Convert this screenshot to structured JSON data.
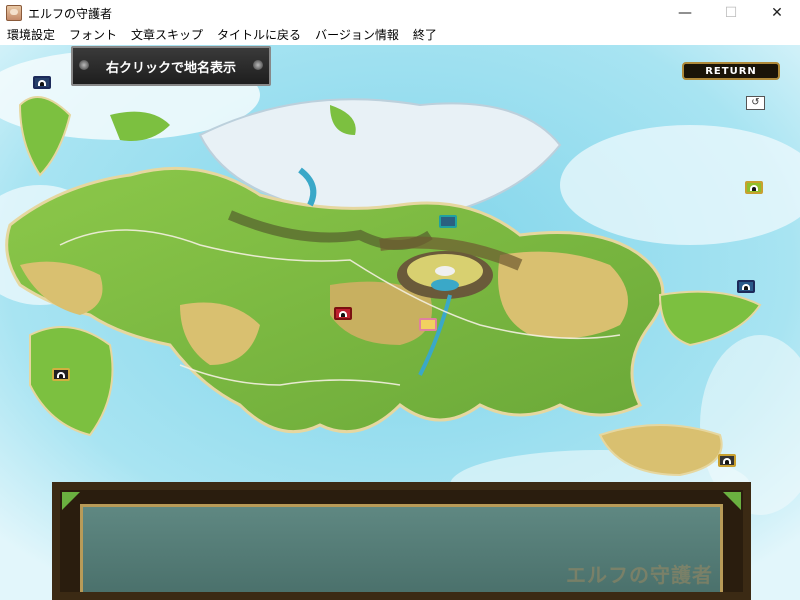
{
  "window": {
    "title": "エルフの守護者",
    "minimize": "—",
    "maximize": "☐",
    "close": "✕"
  },
  "menu": [
    {
      "label": "環境設定"
    },
    {
      "label": "フォント"
    },
    {
      "label": "文章スキップ"
    },
    {
      "label": "タイトルに戻る"
    },
    {
      "label": "バージョン情報"
    },
    {
      "label": "終了"
    }
  ],
  "game": {
    "hint_label": "右クリックで地名表示",
    "return_label": "RETURN",
    "swirl_icon": "swirl-icon",
    "watermark": "エルフの守護者",
    "markers": [
      {
        "name": "marker-northwest-island",
        "color": "#1c2a5a"
      },
      {
        "name": "marker-east-top",
        "color": "#8fbf2a"
      },
      {
        "name": "marker-east-coast",
        "color": "#2a5a8a"
      },
      {
        "name": "marker-central-red",
        "color": "#c02030"
      },
      {
        "name": "marker-west-island",
        "color": "#d0b040"
      },
      {
        "name": "marker-southeast",
        "color": "#c8a030"
      },
      {
        "name": "marker-selected",
        "color": "#e080a0"
      },
      {
        "name": "marker-mountain-gate",
        "color": "#20a0a0"
      }
    ]
  },
  "colors": {
    "sea": "#9fe0f0",
    "land_green": "#7cc040",
    "land_tan": "#d9c070",
    "mountain": "#6a7a3a",
    "snow": "#eef4f8",
    "dialog_frame": "#3b2a14",
    "dialog_fill": "#5a827c"
  }
}
